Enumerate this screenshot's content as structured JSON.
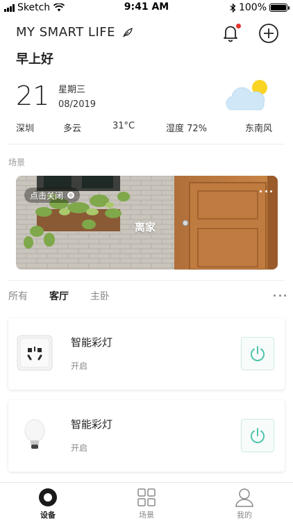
{
  "status_bar": {
    "carrier": "Sketch",
    "time": "9:41 AM",
    "battery": "100%"
  },
  "header": {
    "title": "MY SMART LIFE",
    "notification_badge_color": "#e5322d"
  },
  "greeting": "早上好",
  "date": {
    "day": "21",
    "weekday": "星期三",
    "month_year": "08/2019"
  },
  "weather": {
    "icon": "partly-sunny-icon",
    "city": "深圳",
    "condition": "多云",
    "temperature": "31°C",
    "humidity": "湿度 72%",
    "wind": "东南风"
  },
  "scenes": {
    "section_label": "场景",
    "items": [
      {
        "toggle_label": "点击关闭",
        "name": "离家"
      }
    ]
  },
  "rooms": {
    "tabs": [
      {
        "label": "所有",
        "active": false
      },
      {
        "label": "客厅",
        "active": true
      },
      {
        "label": "主卧",
        "active": false
      }
    ]
  },
  "devices": [
    {
      "name": "智能彩灯",
      "status": "开启",
      "icon": "smart-plug-icon"
    },
    {
      "name": "智能彩灯",
      "status": "开启",
      "icon": "smart-bulb-icon"
    }
  ],
  "tabbar": {
    "items": [
      {
        "label": "设备",
        "icon": "device-icon",
        "active": true
      },
      {
        "label": "场景",
        "icon": "grid-icon",
        "active": false
      },
      {
        "label": "我的",
        "icon": "person-icon",
        "active": false
      }
    ]
  },
  "colors": {
    "accent": "#4fc3a9",
    "text_primary": "#222222",
    "text_secondary": "#888888"
  }
}
